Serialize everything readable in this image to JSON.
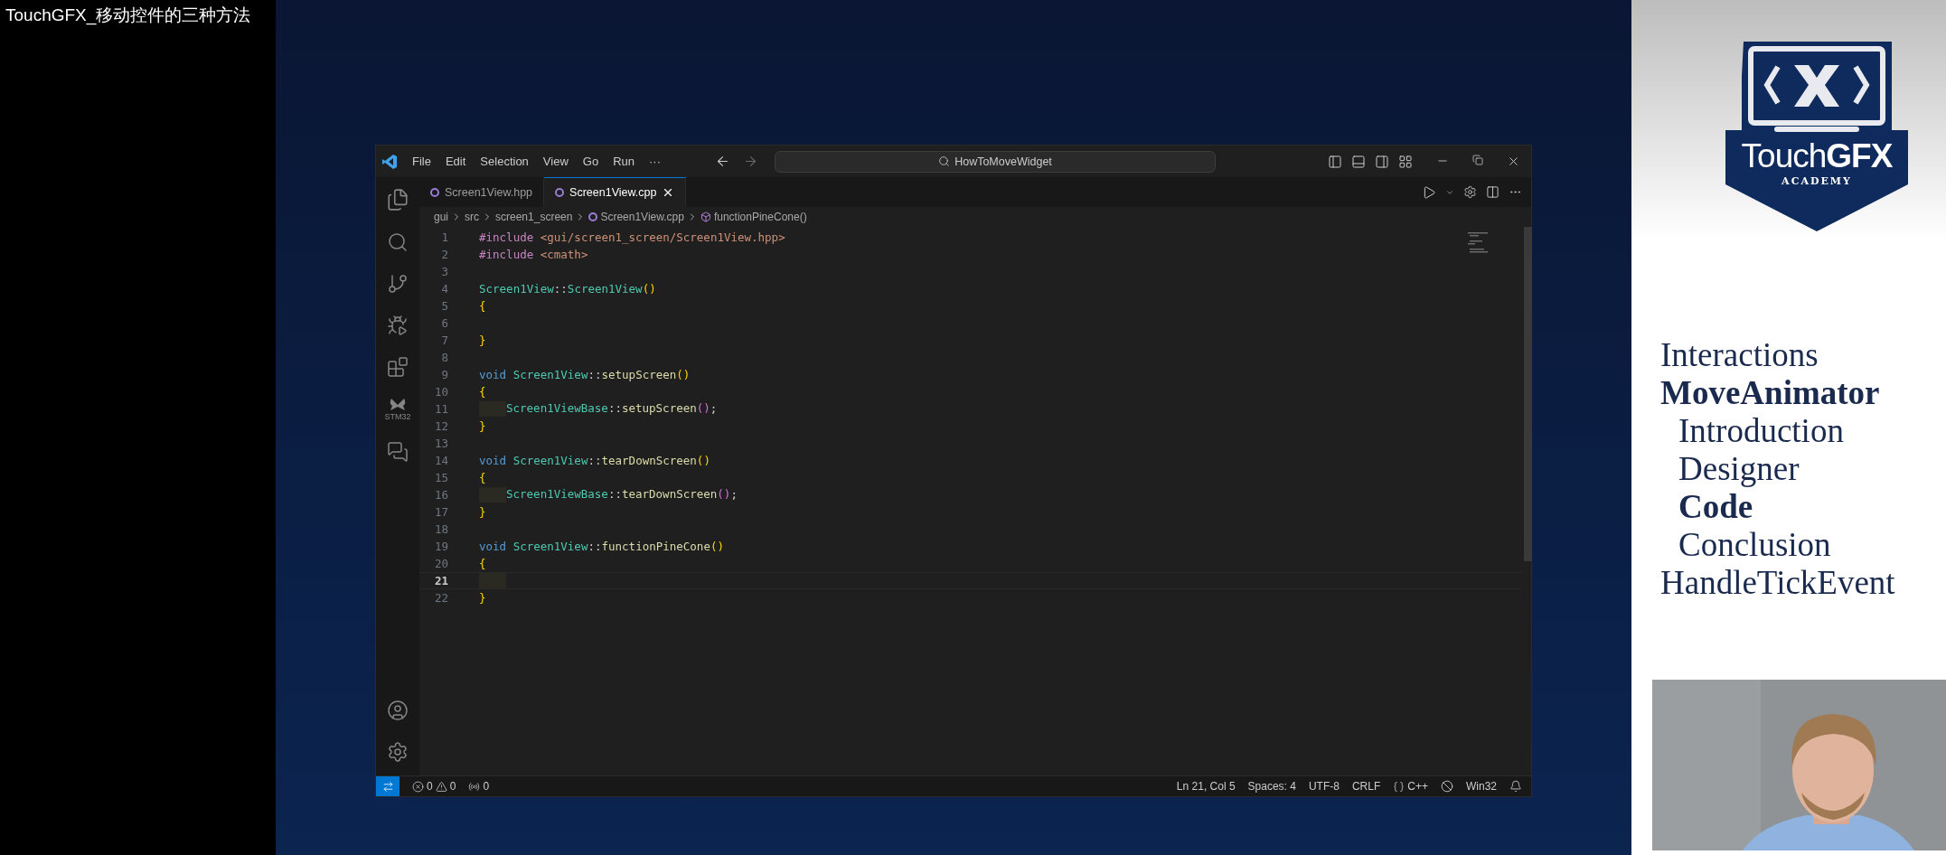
{
  "video_title": "TouchGFX_移动控件的三种方法",
  "editor": {
    "menu": [
      "File",
      "Edit",
      "Selection",
      "View",
      "Go",
      "Run",
      "···"
    ],
    "search": {
      "value": "HowToMoveWidget"
    },
    "tabs": [
      {
        "label": "Screen1View.hpp",
        "selected": false
      },
      {
        "label": "Screen1View.cpp",
        "selected": true
      }
    ],
    "breadcrumb": [
      "gui",
      "src",
      "screen1_screen",
      "Screen1View.cpp",
      "functionPineCone()"
    ],
    "activity_label": "STM32",
    "lines": [
      {
        "number": "1",
        "current": false,
        "indent": false,
        "tokens": [
          {
            "kind": "preproc",
            "text": "#include"
          },
          {
            "kind": "string",
            "text": " <gui/screen1_screen/Screen1View.hpp>"
          }
        ]
      },
      {
        "number": "2",
        "current": false,
        "indent": false,
        "tokens": [
          {
            "kind": "preproc",
            "text": "#include"
          },
          {
            "kind": "string",
            "text": " <cmath>"
          }
        ]
      },
      {
        "number": "3",
        "current": false,
        "indent": false
      },
      {
        "number": "4",
        "current": false,
        "indent": false,
        "tokens": [
          {
            "kind": "type",
            "text": "Screen1View"
          },
          {
            "kind": "punct",
            "text": "::"
          },
          {
            "kind": "type",
            "text": "Screen1View"
          },
          {
            "kind": "bracket",
            "text": "()"
          }
        ]
      },
      {
        "number": "5",
        "current": false,
        "indent": false,
        "tokens": [
          {
            "kind": "bracket",
            "text": "{"
          }
        ]
      },
      {
        "number": "6",
        "current": false,
        "indent": false
      },
      {
        "number": "7",
        "current": false,
        "indent": false,
        "tokens": [
          {
            "kind": "bracket",
            "text": "}"
          }
        ]
      },
      {
        "number": "8",
        "current": false,
        "indent": false
      },
      {
        "number": "9",
        "current": false,
        "indent": false,
        "tokens": [
          {
            "kind": "keyword",
            "text": "void "
          },
          {
            "kind": "type",
            "text": "Screen1View"
          },
          {
            "kind": "punct",
            "text": "::"
          },
          {
            "kind": "func",
            "text": "setupScreen"
          },
          {
            "kind": "bracket",
            "text": "()"
          }
        ]
      },
      {
        "number": "10",
        "current": false,
        "indent": false,
        "tokens": [
          {
            "kind": "bracket",
            "text": "{"
          }
        ]
      },
      {
        "number": "11",
        "current": false,
        "indent": true,
        "tokens": [
          {
            "kind": "type",
            "text": "Screen1ViewBase"
          },
          {
            "kind": "punct",
            "text": "::"
          },
          {
            "kind": "func",
            "text": "setupScreen"
          },
          {
            "kind": "bracket2",
            "text": "()"
          },
          {
            "kind": "punct",
            "text": ";"
          }
        ]
      },
      {
        "number": "12",
        "current": false,
        "indent": false,
        "tokens": [
          {
            "kind": "bracket",
            "text": "}"
          }
        ]
      },
      {
        "number": "13",
        "current": false,
        "indent": false
      },
      {
        "number": "14",
        "current": false,
        "indent": false,
        "tokens": [
          {
            "kind": "keyword",
            "text": "void "
          },
          {
            "kind": "type",
            "text": "Screen1View"
          },
          {
            "kind": "punct",
            "text": "::"
          },
          {
            "kind": "func",
            "text": "tearDownScreen"
          },
          {
            "kind": "bracket",
            "text": "()"
          }
        ]
      },
      {
        "number": "15",
        "current": false,
        "indent": false,
        "tokens": [
          {
            "kind": "bracket",
            "text": "{"
          }
        ]
      },
      {
        "number": "16",
        "current": false,
        "indent": true,
        "tokens": [
          {
            "kind": "type",
            "text": "Screen1ViewBase"
          },
          {
            "kind": "punct",
            "text": "::"
          },
          {
            "kind": "func",
            "text": "tearDownScreen"
          },
          {
            "kind": "bracket2",
            "text": "()"
          },
          {
            "kind": "punct",
            "text": ";"
          }
        ]
      },
      {
        "number": "17",
        "current": false,
        "indent": false,
        "tokens": [
          {
            "kind": "bracket",
            "text": "}"
          }
        ]
      },
      {
        "number": "18",
        "current": false,
        "indent": false
      },
      {
        "number": "19",
        "current": false,
        "indent": false,
        "tokens": [
          {
            "kind": "keyword",
            "text": "void "
          },
          {
            "kind": "type",
            "text": "Screen1View"
          },
          {
            "kind": "punct",
            "text": "::"
          },
          {
            "kind": "func",
            "text": "functionPineCone"
          },
          {
            "kind": "bracket",
            "text": "()"
          }
        ]
      },
      {
        "number": "20",
        "current": false,
        "indent": false,
        "tokens": [
          {
            "kind": "bracket",
            "text": "{"
          }
        ]
      },
      {
        "number": "21",
        "current": true,
        "indent": true
      },
      {
        "number": "22",
        "current": false,
        "indent": false,
        "tokens": [
          {
            "kind": "bracket",
            "text": "}"
          }
        ]
      }
    ],
    "status": {
      "errors": "0",
      "warnings": "0",
      "ports": "0",
      "position": "Ln 21, Col 5",
      "spaces": "Spaces: 4",
      "encoding": "UTF-8",
      "eol": "CRLF",
      "language": "C++",
      "platform": "Win32"
    }
  },
  "logo": {
    "title": "Touch**GFX**",
    "subtitle": "ACADEMY"
  },
  "outline": [
    {
      "label": "Interactions",
      "selected": false
    },
    {
      "label": "MoveAnimator",
      "selected": true,
      "children": [
        {
          "label": "Introduction",
          "selected": false
        },
        {
          "label": "Designer",
          "selected": false
        },
        {
          "label": "Code",
          "selected": true
        },
        {
          "label": "Conclusion",
          "selected": false
        }
      ]
    },
    {
      "label": "HandleTickEvent",
      "selected": false
    }
  ]
}
